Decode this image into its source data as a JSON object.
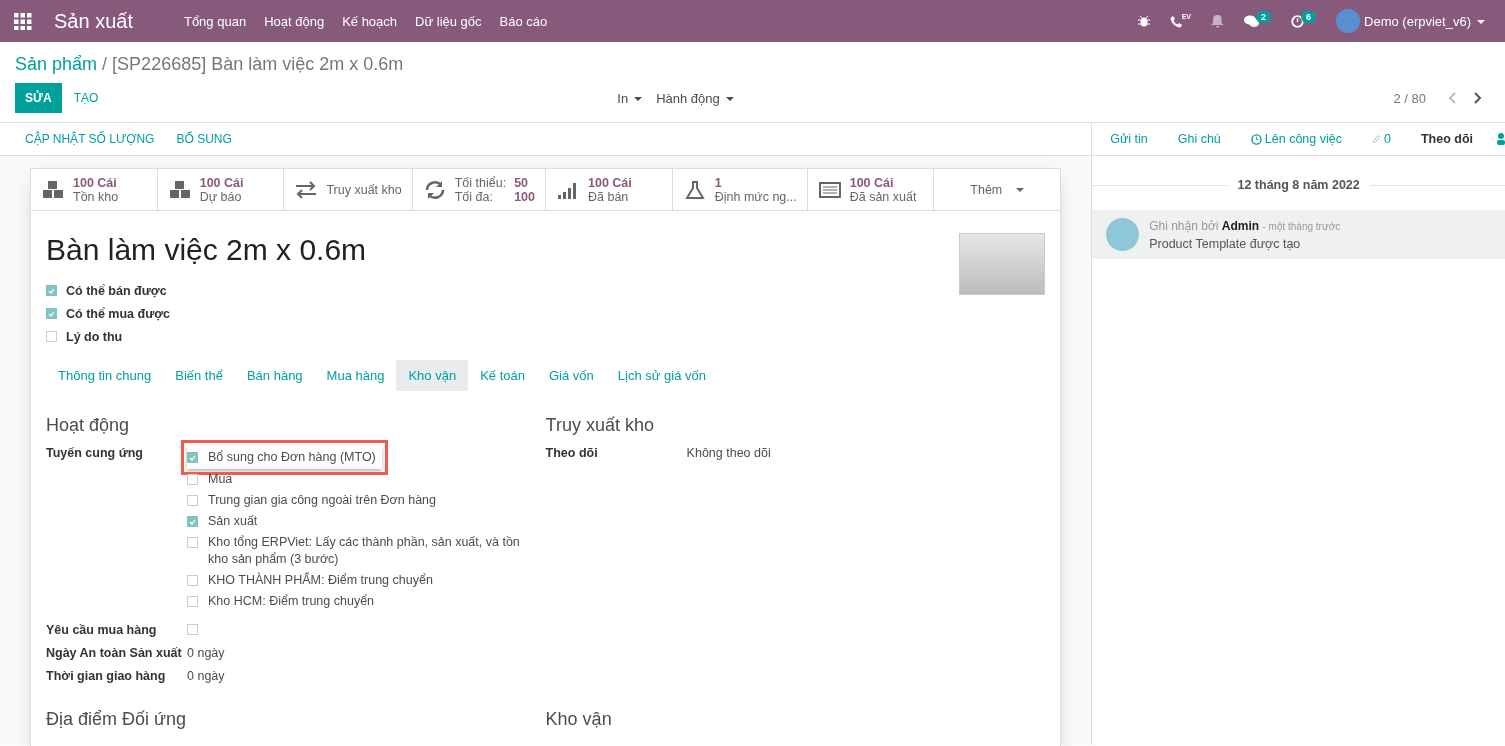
{
  "topbar": {
    "app_title": "Sản xuất",
    "menu": [
      "Tổng quan",
      "Hoạt động",
      "Kế hoạch",
      "Dữ liệu gốc",
      "Báo cáo"
    ],
    "voip_label": "EV",
    "messages_count": "2",
    "activities_count": "6",
    "user": "Demo (erpviet_v6)"
  },
  "breadcrumb": {
    "parent": "Sản phẩm",
    "separator": "/",
    "current": "[SP226685] Bàn làm việc 2m x 0.6m"
  },
  "actions": {
    "edit": "SỬA",
    "create": "TẠO",
    "dropdowns": [
      "In",
      "Hành động"
    ],
    "pager": "2 / 80"
  },
  "header_buttons": [
    "CẬP NHẬT SỐ LƯỢNG",
    "BỔ SUNG"
  ],
  "stat_buttons": [
    {
      "kind": "cubes",
      "value": "100 Cái",
      "label": "Tồn kho"
    },
    {
      "kind": "cubes",
      "value": "100 Cái",
      "label": "Dự báo"
    },
    {
      "kind": "transfer",
      "label": "Truy xuất kho"
    },
    {
      "kind": "minmax",
      "min_label": "Tối thiểu:",
      "min": "50",
      "max_label": "Tối đa:",
      "max": "100"
    },
    {
      "kind": "signal",
      "value": "100 Cái",
      "label": "Đã bán"
    },
    {
      "kind": "flask",
      "value": "1",
      "label": "Định mức ng..."
    },
    {
      "kind": "list",
      "value": "100 Cái",
      "label": "Đã sản xuất"
    },
    {
      "kind": "more",
      "label": "Thêm"
    }
  ],
  "product": {
    "name": "Bàn làm việc 2m x 0.6m",
    "options": [
      {
        "label": "Có thể bán được",
        "checked": true
      },
      {
        "label": "Có thể mua được",
        "checked": true
      },
      {
        "label": "Lý do thu",
        "checked": false
      }
    ]
  },
  "tabs": [
    {
      "label": "Thông tin chung",
      "selected": false
    },
    {
      "label": "Biến thể",
      "selected": false
    },
    {
      "label": "Bán hàng",
      "selected": false
    },
    {
      "label": "Mua hàng",
      "selected": false
    },
    {
      "label": "Kho vận",
      "selected": true
    },
    {
      "label": "Kế toán",
      "selected": false
    },
    {
      "label": "Giá vốn",
      "selected": false
    },
    {
      "label": "Lịch sử giá vốn",
      "selected": false
    }
  ],
  "operations": {
    "title": "Hoạt động",
    "routes_label": "Tuyến cung ứng",
    "routes": [
      {
        "label": "Bổ sung cho Đơn hàng (MTO)",
        "checked": true,
        "highlighted": true
      },
      {
        "label": "Mua",
        "checked": false,
        "highlighted": false
      },
      {
        "label": "Trung gian gia công ngoài trên Đơn hàng",
        "checked": false,
        "highlighted": false
      },
      {
        "label": "Sản xuất",
        "checked": true,
        "highlighted": false
      },
      {
        "label": "Kho tổng ERPViet: Lấy các thành phần, sản xuất, và tồn kho sản phẩm (3 bước)",
        "checked": false,
        "highlighted": false
      },
      {
        "label": "KHO THÀNH PHẨM: Điểm trung chuyển",
        "checked": false,
        "highlighted": false
      },
      {
        "label": "Kho HCM: Điểm trung chuyển",
        "checked": false,
        "highlighted": false
      }
    ],
    "purchase_request": {
      "label": "Yêu cầu mua hàng",
      "checked": false
    },
    "fields": [
      {
        "label": "Ngày An toàn Sản xuất",
        "value": "0 ngày"
      },
      {
        "label": "Thời gian giao hàng",
        "value": "0 ngày"
      }
    ]
  },
  "traceability": {
    "title": "Truy xuất kho",
    "label": "Theo dõi",
    "value": "Không theo dõi"
  },
  "bottom_sections": [
    "Địa điểm Đối ứng",
    "Kho vận"
  ],
  "chatter": {
    "actions": [
      {
        "kind": "link",
        "label": "Gửi tin"
      },
      {
        "kind": "link",
        "label": "Ghi chú"
      },
      {
        "kind": "activity",
        "label": "Lên công việc"
      },
      {
        "kind": "attachment",
        "label": "0"
      },
      {
        "kind": "follow",
        "label": "Theo dõi"
      },
      {
        "kind": "followers"
      }
    ],
    "date": "12 tháng 8 năm 2022",
    "message": {
      "prefix": "Ghi nhận bởi",
      "author": "Admin",
      "time": "- một tháng trước",
      "body": "Product Template được tạo"
    }
  }
}
